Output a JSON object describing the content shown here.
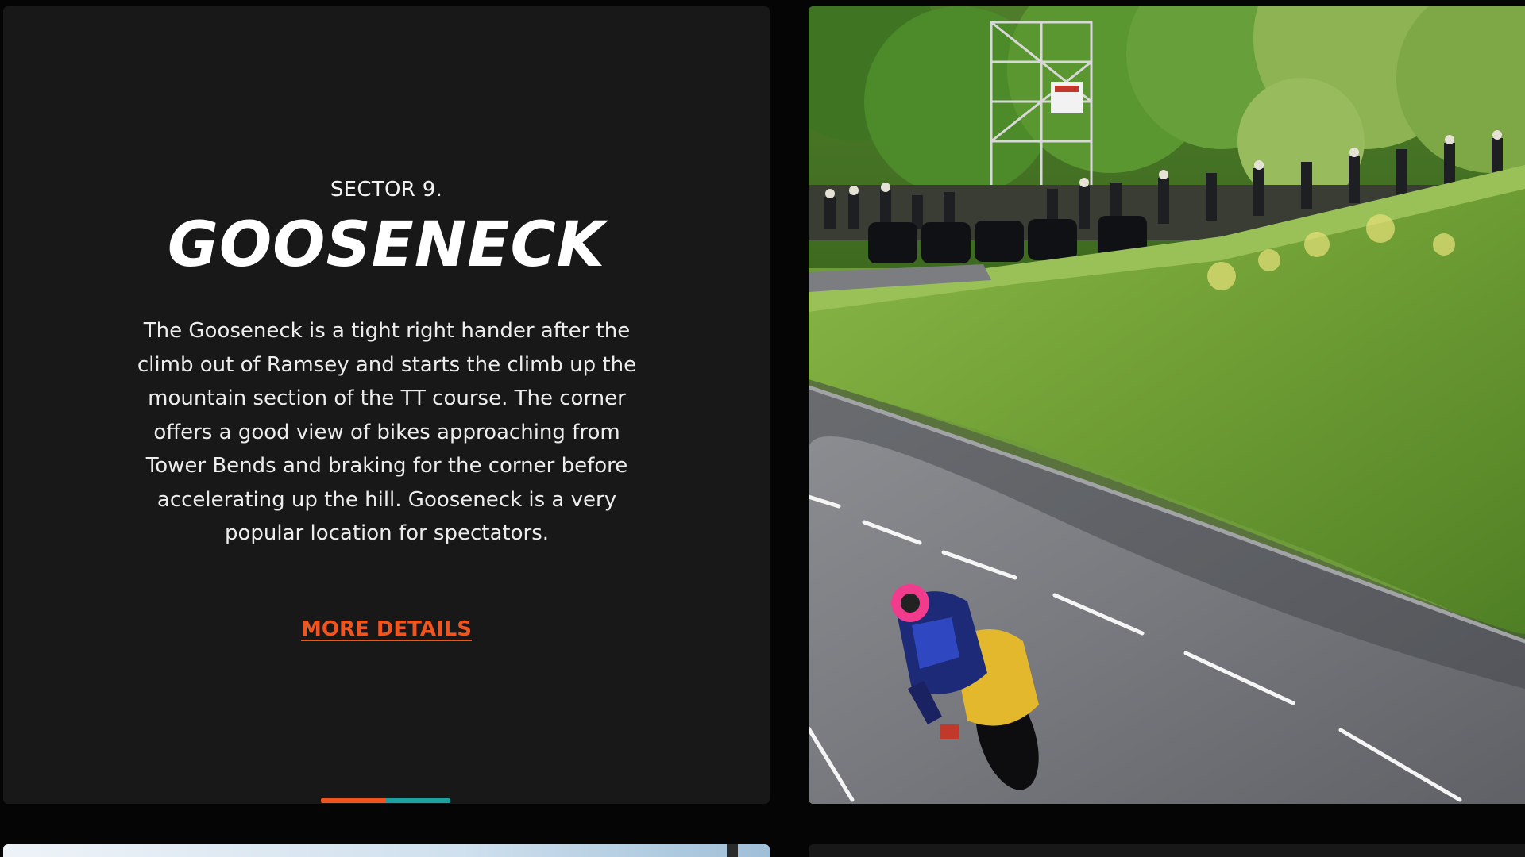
{
  "sector": {
    "label": "SECTOR 9.",
    "title": "GOOSENECK",
    "description": "The Gooseneck is a tight right hander after the climb out of Ramsey and starts the climb up the mountain section of the TT course. The corner offers a good view of bikes approaching from Tower Bends and braking for the corner before accelerating up the hill. Gooseneck is a very popular location for spectators.",
    "more_details_label": "MORE DETAILS"
  },
  "carousel": {
    "progress_segments": [
      {
        "name": "active",
        "color": "#f0541f",
        "fraction": 0.5
      },
      {
        "name": "remaining",
        "color": "#1aa1a0",
        "fraction": 0.5
      }
    ]
  },
  "colors": {
    "accent": "#f0541f",
    "teal": "#1aa1a0",
    "card_bg": "#181818",
    "page_bg": "#050505"
  }
}
